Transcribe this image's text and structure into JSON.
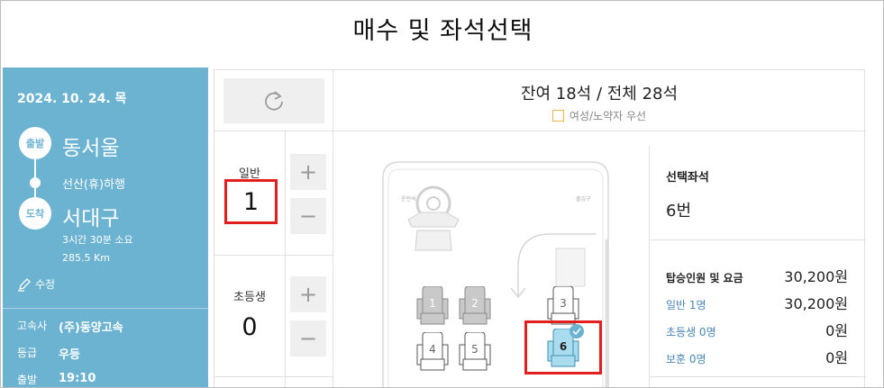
{
  "header": {
    "title": "매수 및 좌석선택"
  },
  "trip": {
    "date": "2024. 10. 24. 목",
    "departure_badge": "출발",
    "departure": "동서울",
    "via": "선산(휴)하행",
    "arrival_badge": "도착",
    "arrival": "서대구",
    "duration": "3시간 30분 소요",
    "distance": "285.5 Km",
    "edit_label": "수정",
    "info": [
      {
        "key": "고속사",
        "value": "(주)동양고속"
      },
      {
        "key": "등급",
        "value": "우등"
      },
      {
        "key": "출발",
        "value": "19:10"
      }
    ]
  },
  "seat_status": {
    "text": "잔여 18석 / 전체 28석",
    "preference_label": "여성/노약자 우선"
  },
  "passengers": [
    {
      "label": "일반",
      "count": "1"
    },
    {
      "label": "초등생",
      "count": "0"
    }
  ],
  "seatmap": {
    "driver_label": "운전석",
    "door_label": "출입구",
    "seats": [
      {
        "number": "1",
        "state": "taken"
      },
      {
        "number": "2",
        "state": "taken"
      },
      {
        "number": "3",
        "state": "available"
      },
      {
        "number": "4",
        "state": "available"
      },
      {
        "number": "5",
        "state": "available"
      },
      {
        "number": "6",
        "state": "selected"
      }
    ]
  },
  "summary": {
    "selected_title": "선택좌석",
    "selected_value": "6번",
    "fare_title": "탑승인원 및 요금",
    "fare_total": "30,200원",
    "rows": [
      {
        "label": "일반 1명",
        "amount": "30,200원"
      },
      {
        "label": "초등생 0명",
        "amount": "0원"
      },
      {
        "label": "보훈 0명",
        "amount": "0원"
      }
    ]
  },
  "colors": {
    "panel": "#6bb3d1",
    "selected_seat": "#a9dcee",
    "highlight": "#e31e1e",
    "link": "#4a86b3"
  }
}
